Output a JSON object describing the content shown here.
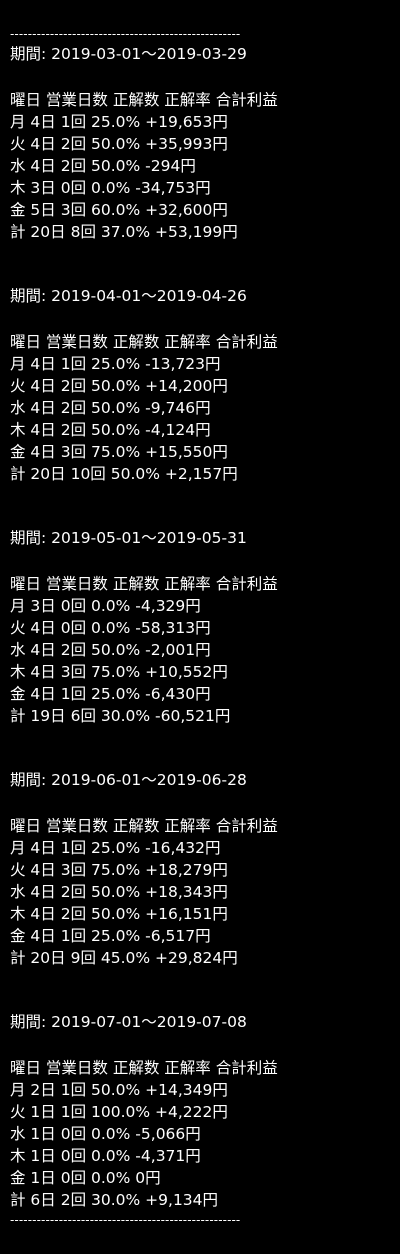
{
  "separator": "----------------------------------------------------",
  "periods": [
    {
      "title": "期間: 2019-03-01～2019-03-29",
      "header": "曜日 営業日数 正解数 正解率 合計利益",
      "rows": [
        "月 4日 1回 25.0% +19,653円",
        "火 4日 2回 50.0% +35,993円",
        "水 4日 2回 50.0% -294円",
        "木 3日 0回 0.0% -34,753円",
        "金 5日 3回 60.0% +32,600円",
        "計 20日 8回 37.0% +53,199円"
      ]
    },
    {
      "title": "期間: 2019-04-01～2019-04-26",
      "header": "曜日 営業日数 正解数 正解率 合計利益",
      "rows": [
        "月 4日 1回 25.0% -13,723円",
        "火 4日 2回 50.0% +14,200円",
        "水 4日 2回 50.0% -9,746円",
        "木 4日 2回 50.0% -4,124円",
        "金 4日 3回 75.0% +15,550円",
        "計 20日 10回 50.0% +2,157円"
      ]
    },
    {
      "title": "期間: 2019-05-01～2019-05-31",
      "header": "曜日 営業日数 正解数 正解率 合計利益",
      "rows": [
        "月 3日 0回 0.0% -4,329円",
        "火 4日 0回 0.0% -58,313円",
        "水 4日 2回 50.0% -2,001円",
        "木 4日 3回 75.0% +10,552円",
        "金 4日 1回 25.0% -6,430円",
        "計 19日 6回 30.0% -60,521円"
      ]
    },
    {
      "title": "期間: 2019-06-01～2019-06-28",
      "header": "曜日 営業日数 正解数 正解率 合計利益",
      "rows": [
        "月 4日 1回 25.0% -16,432円",
        "火 4日 3回 75.0% +18,279円",
        "水 4日 2回 50.0% +18,343円",
        "木 4日 2回 50.0% +16,151円",
        "金 4日 1回 25.0% -6,517円",
        "計 20日 9回 45.0% +29,824円"
      ]
    },
    {
      "title": "期間: 2019-07-01～2019-07-08",
      "header": "曜日 営業日数 正解数 正解率 合計利益",
      "rows": [
        "月 2日 1回 50.0% +14,349円",
        "火 1日 1回 100.0% +4,222円",
        "水 1日 0回 0.0% -5,066円",
        "木 1日 0回 0.0% -4,371円",
        "金 1日 0回 0.0% 0円",
        "計 6日 2回 30.0% +9,134円"
      ]
    }
  ]
}
